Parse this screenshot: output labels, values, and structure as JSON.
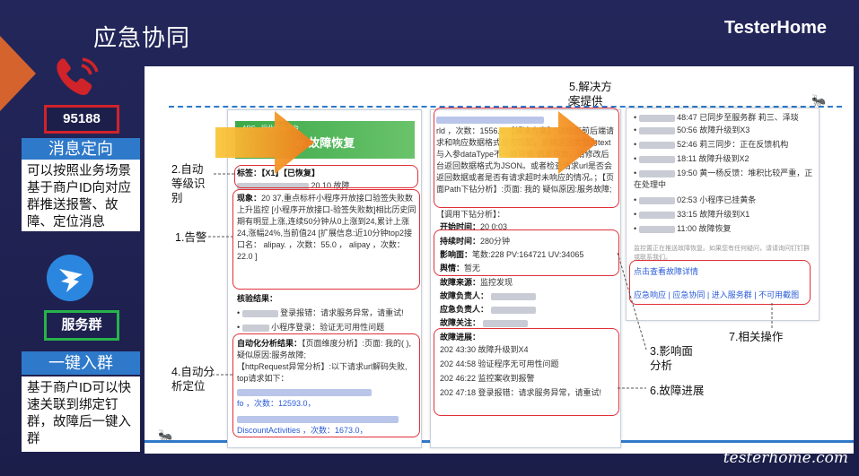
{
  "header": {
    "title": "应急协同",
    "brand": "TesterHome"
  },
  "sidebar": {
    "hotline": "95188",
    "section1_title": "消息定向",
    "section1_body": "可以按照业务场景基于商户ID向对应群推送报警、故障、定位消息",
    "group_badge": "服务群",
    "section2_title": "一键入群",
    "section2_body": "基于商户ID可以快速关联到绑定钉群，故障后一键入群"
  },
  "panel1": {
    "banner": "故障恢复",
    "banner_small": "ARC · 行业应急中台",
    "tag_line": "标签：【X1】【已恢复】",
    "tag_tail": "20 10 故障",
    "phenomenon_label": "现象：",
    "phenomenon_text": "20 37,重点标杆小程序开放接口验签失败数上升监控 [小程序开放接口-验签失败数]相比历史同期有明显上涨,连续50分钟从0上涨到24,累计上涨24,涨幅24%,当前值24 [扩展信息:近10分钟top2接口名： alipay. ，次数：55.0 ， alipay ，次数：22.0 ]",
    "verify_label": "核验结果：",
    "verify_1": "登录报错：请求服务异常，请重试!",
    "verify_2": "小程序登录：验证无可用性问题",
    "auto_label": "自动化分析结果：",
    "auto_text": "【页面维度分析】:页面: 我的( ),疑似原因:服务故障;",
    "auto_text2": "【httpRequest异常分析】:以下请求url解码失败, top请求如下：",
    "auto_link": "fo ，次数：12593.0，",
    "auto_link2": "DiscountActivities ，次数：1673.0，"
  },
  "panel2": {
    "top_text": "rld ，次数：1556.0 【解决方案】:请检查前后端请求和响应数据格式是否匹配，后端返回类型为text与入参dataType不一致导致 请求导致，请修改后台返回数据格式为JSON。或者检查请求url是否会返回数据或者是否有请求超时未响应的情况。；【页面Path下钻分析】:页面: 我的 疑似原因:服务故障;",
    "drill_tail": "【调用下钻分析】：",
    "start_label": "开始时间：",
    "start_val": "20 0:03",
    "dur_label": "持续时间：",
    "dur_val": "280分钟",
    "impact_label": "影响面：",
    "impact_val": "笔数:228 PV:164721 UV:34065",
    "opinion_label": "舆情：",
    "opinion_val": "暂无",
    "source_label": "故障来源：",
    "source_val": "监控发现",
    "owner_label": "故障负责人：",
    "emerg_label": "应急负责人：",
    "follow_label": "故障关注：",
    "progress_label": "故障进展：",
    "progress": [
      "202 43:30 故障升级到X4",
      "202 44:58 验证程序无可用性问题",
      "202 46:22 监控案收到报警",
      "202 47:18 登录报错：请求服务异常，请重试!"
    ]
  },
  "panel3": {
    "log": [
      "48:47 已同步至服务群 莉三、泽琰",
      "50:56 故障升级到X3",
      "52:46 莉三同步：正在反馈机构",
      "18:11 故障升级到X2",
      "19:50 黄一杨反馈：堆积比较严重，正在处理中",
      "02:53 小程序已挂黄条",
      "33:15 故障升级到X1",
      "11:00 故障恢复"
    ],
    "note": "监控置正在推送故障恢复。如果您有任何疑问，请请询问钉钉群或联系我们。",
    "detail_link": "点击查看故障详情",
    "actions": [
      "应急响应",
      "应急协同",
      "进入服务群",
      "不可用截图"
    ]
  },
  "callouts": {
    "c1": "1.告警",
    "c2": "2.自动等级识别",
    "c3": "3.影响面分析",
    "c4": "4.自动分析定位",
    "c5": "5.解决方案提供",
    "c6": "6.故障进展",
    "c7": "7.相关操作"
  },
  "watermark": "testerhome.com",
  "colors": {
    "accent": "#2e79c9",
    "alert": "#e0303a",
    "green": "#27b34a"
  }
}
